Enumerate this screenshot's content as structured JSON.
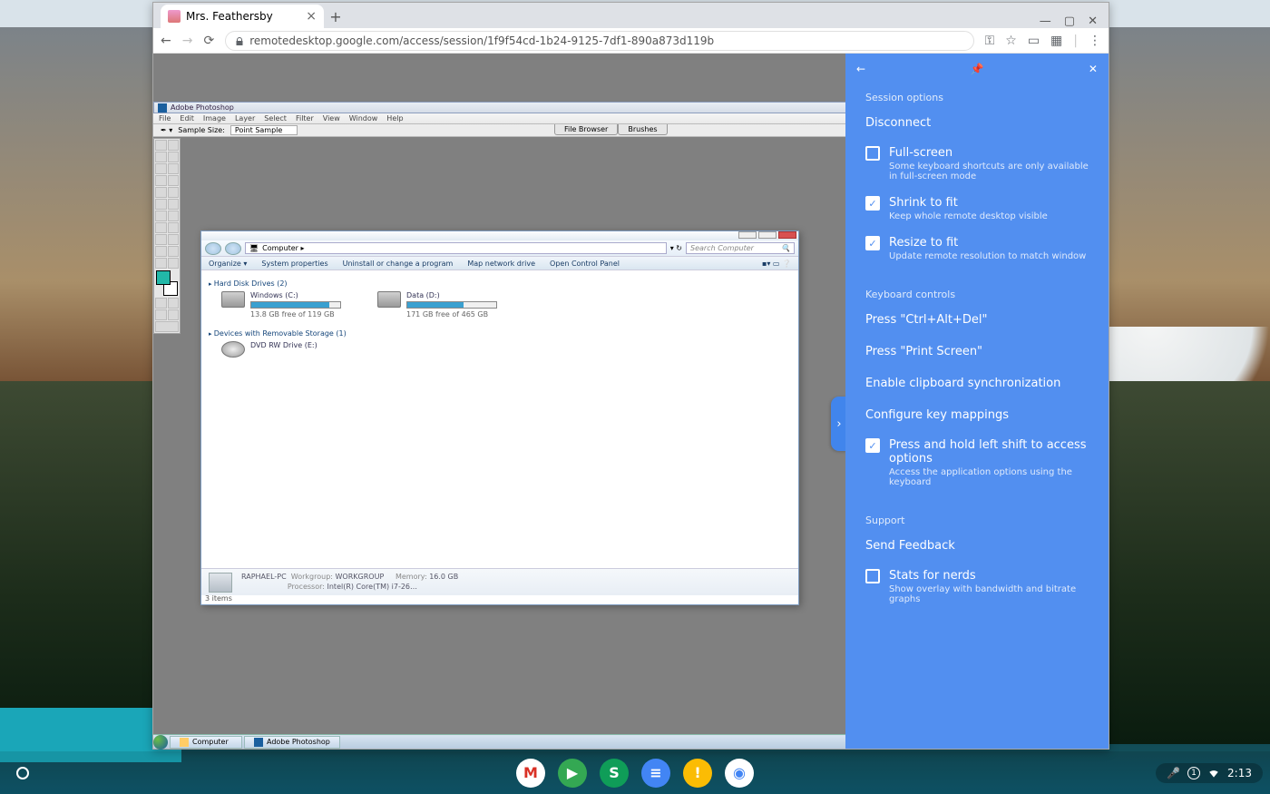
{
  "wallpaper": {
    "desc": "Mountain landscape with trees and lake"
  },
  "chrome": {
    "tab_title": "Mrs. Feathersby",
    "url": "remotedesktop.google.com/access/session/1f9f54cd-1b24-9125-7df1-890a873d119b",
    "window_minimize": "—",
    "window_maximize": "▢",
    "window_close": "✕"
  },
  "remote": {
    "ps": {
      "title": "Adobe Photoshop",
      "menu": [
        "File",
        "Edit",
        "Image",
        "Layer",
        "Select",
        "Filter",
        "View",
        "Window",
        "Help"
      ],
      "option_label": "Sample Size:",
      "option_value": "Point Sample",
      "tabs": [
        "File Browser",
        "Brushes"
      ]
    },
    "explorer": {
      "address": "Computer ▸",
      "search_placeholder": "Search Computer",
      "toolbar": [
        "Organize ▾",
        "System properties",
        "Uninstall or change a program",
        "Map network drive",
        "Open Control Panel"
      ],
      "section_hdd": "Hard Disk Drives (2)",
      "drives": [
        {
          "name": "Windows (C:)",
          "free": "13.8 GB free of 119 GB",
          "fillPct": 88
        },
        {
          "name": "Data (D:)",
          "free": "171 GB free of 465 GB",
          "fillPct": 63
        }
      ],
      "section_removable": "Devices with Removable Storage (1)",
      "dvd": "DVD RW Drive (E:)",
      "status_name": "RAPHAEL-PC",
      "status_workgroup_label": "Workgroup:",
      "status_workgroup": "WORKGROUP",
      "status_mem_label": "Memory:",
      "status_mem": "16.0 GB",
      "status_proc_label": "Processor:",
      "status_proc": "Intel(R) Core(TM) i7-26…",
      "item_count": "3 items"
    },
    "taskbar": {
      "computer": "Computer",
      "photoshop": "Adobe Photoshop"
    }
  },
  "panel": {
    "session_hdr": "Session options",
    "disconnect": "Disconnect",
    "fullscreen": {
      "label": "Full-screen",
      "desc": "Some keyboard shortcuts are only available in full-screen mode",
      "checked": false
    },
    "shrink": {
      "label": "Shrink to fit",
      "desc": "Keep whole remote desktop visible",
      "checked": true
    },
    "resize": {
      "label": "Resize to fit",
      "desc": "Update remote resolution to match window",
      "checked": true
    },
    "keyboard_hdr": "Keyboard controls",
    "cad": "Press \"Ctrl+Alt+Del\"",
    "prtscr": "Press \"Print Screen\"",
    "clipboard": "Enable clipboard synchronization",
    "mappings": "Configure key mappings",
    "shift": {
      "label": "Press and hold left shift to access options",
      "desc": "Access the application options using the keyboard",
      "checked": true
    },
    "support_hdr": "Support",
    "feedback": "Send Feedback",
    "stats": {
      "label": "Stats for nerds",
      "desc": "Show overlay with bandwidth and bitrate graphs",
      "checked": false
    }
  },
  "shelf": {
    "apps": [
      {
        "name": "gmail",
        "letter": "M",
        "bg": "#ffffff",
        "fg": "#d93025"
      },
      {
        "name": "messages",
        "letter": "▶",
        "bg": "#34a853",
        "fg": "#fff"
      },
      {
        "name": "slides",
        "letter": "S",
        "bg": "#0f9d58",
        "fg": "#fff"
      },
      {
        "name": "docs",
        "letter": "≡",
        "bg": "#4285f4",
        "fg": "#fff"
      },
      {
        "name": "keep",
        "letter": "!",
        "bg": "#fbbc04",
        "fg": "#fff"
      },
      {
        "name": "chrome",
        "letter": "◉",
        "bg": "#fff",
        "fg": "#4285f4"
      }
    ],
    "battery": "1",
    "time": "2:13"
  }
}
